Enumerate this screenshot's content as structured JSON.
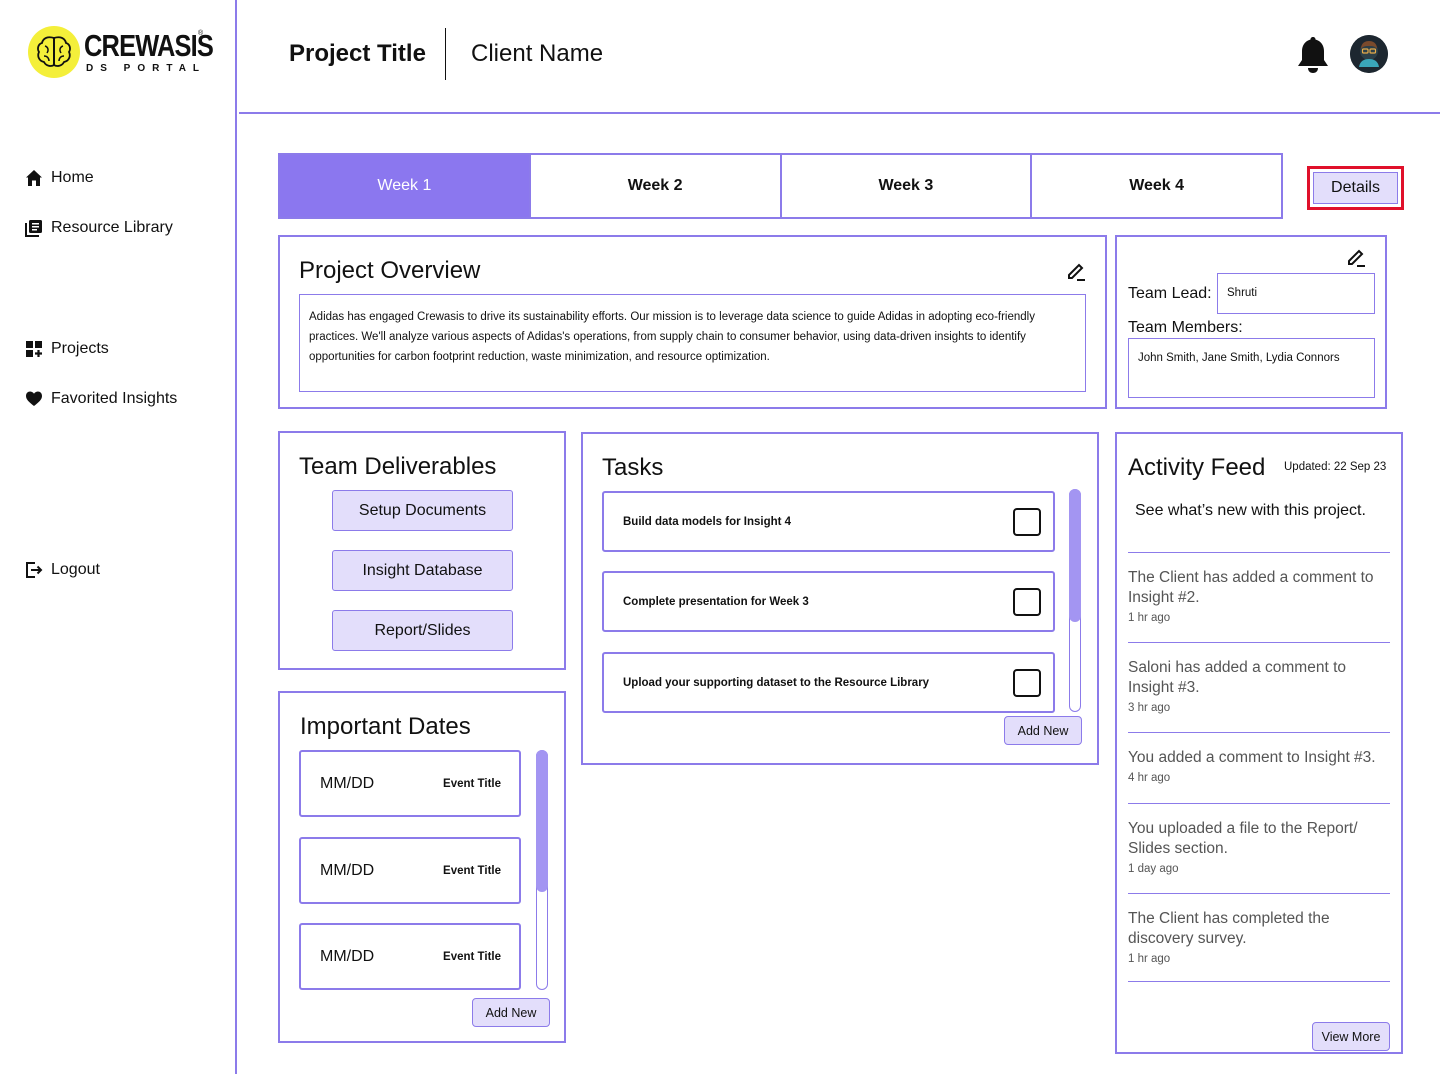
{
  "brand": {
    "name": "CREWASIS",
    "sub": "DS PORTAL",
    "reg": "®",
    "logo_icon": "brain-icon",
    "accent": "#8b77ef",
    "logo_color": "#f4ef3a"
  },
  "sidebar": {
    "items": [
      {
        "label": "Home",
        "icon": "home-icon"
      },
      {
        "label": "Resource Library",
        "icon": "library-icon"
      },
      {
        "label": "Projects",
        "icon": "grid-icon"
      },
      {
        "label": "Favorited Insights",
        "icon": "heart-icon"
      },
      {
        "label": "Logout",
        "icon": "logout-icon"
      }
    ]
  },
  "header": {
    "project_title": "Project Title",
    "client_name": "Client Name",
    "bell_icon": "bell-icon",
    "avatar_icon": "avatar-icon"
  },
  "tabs": [
    {
      "label": "Week 1",
      "active": true
    },
    {
      "label": "Week 2",
      "active": false
    },
    {
      "label": "Week 3",
      "active": false
    },
    {
      "label": "Week 4",
      "active": false
    }
  ],
  "details_label": "Details",
  "overview": {
    "title": "Project Overview",
    "text": "Adidas has engaged Crewasis to drive its sustainability efforts. Our mission is to leverage data science to guide Adidas in adopting eco-friendly practices. We'll analyze various aspects of Adidas's operations, from supply chain to consumer behavior, using data-driven insights to identify opportunities for carbon footprint reduction, waste minimization, and resource optimization."
  },
  "team": {
    "lead_label": "Team Lead:",
    "lead_value": "Shruti",
    "members_label": "Team Members:",
    "members_value": "John Smith, Jane Smith, Lydia Connors"
  },
  "deliverables": {
    "title": "Team Deliverables",
    "buttons": [
      "Setup Documents",
      "Insight Database",
      "Report/Slides"
    ]
  },
  "dates": {
    "title": "Important Dates",
    "items": [
      {
        "date": "MM/DD",
        "event": "Event Title"
      },
      {
        "date": "MM/DD",
        "event": "Event Title"
      },
      {
        "date": "MM/DD",
        "event": "Event Title"
      }
    ],
    "add_label": "Add New"
  },
  "tasks": {
    "title": "Tasks",
    "items": [
      {
        "text": "Build data models for Insight 4",
        "checked": false
      },
      {
        "text": "Complete presentation for Week 3",
        "checked": false
      },
      {
        "text": "Upload your supporting dataset to the Resource Library",
        "checked": false
      }
    ],
    "add_label": "Add New"
  },
  "feed": {
    "title": "Activity Feed",
    "updated": "Updated: 22 Sep 23",
    "subtitle": "See what’s new with this project.",
    "items": [
      {
        "text": "The Client has added a comment to Insight #2.",
        "time": "1 hr ago"
      },
      {
        "text": "Saloni has added a comment to Insight #3.",
        "time": "3 hr ago"
      },
      {
        "text": "You added a comment to Insight #3.",
        "time": "4 hr ago"
      },
      {
        "text": "You uploaded a file to the Report/ Slides section.",
        "time": "1 day ago"
      },
      {
        "text": "The Client has completed the discovery survey.",
        "time": "1 hr ago"
      }
    ],
    "view_more": "View More"
  }
}
